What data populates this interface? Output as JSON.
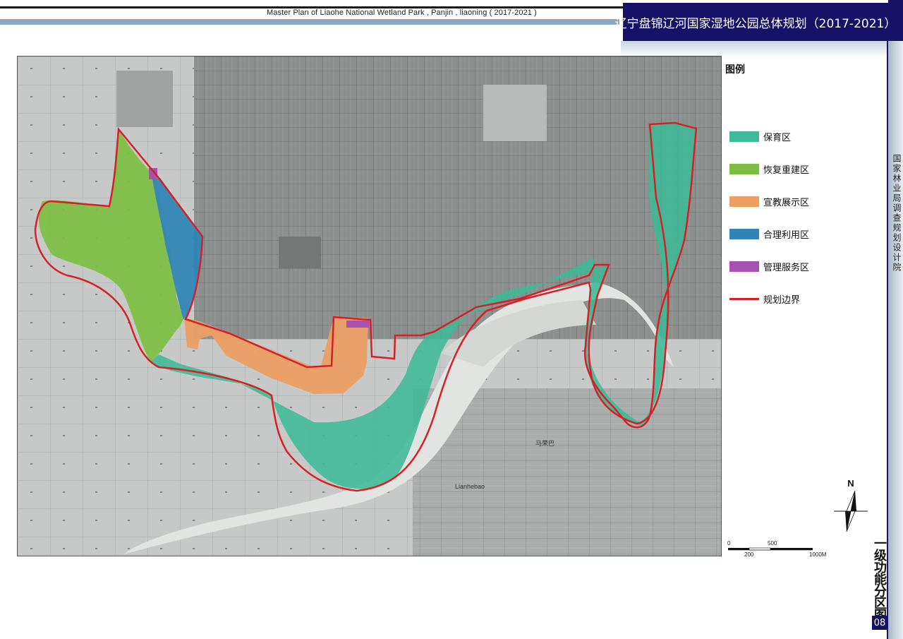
{
  "header": {
    "english_title": "Master Plan of Liaohe National Wetland Park , Panjin , liaoning ( 2017-2021 )",
    "chinese_title": "辽宁盘锦辽河国家湿地公园总体规划（2017-2021）"
  },
  "sidebar": {
    "organization": "国家林业局调查规划设计院",
    "map_title": "一级功能分区图",
    "page_number": "08"
  },
  "legend": {
    "title": "图例",
    "items": [
      {
        "label": "保育区",
        "color": "#3dba97",
        "kind": "fill"
      },
      {
        "label": "恢复重建区",
        "color": "#7cbe42",
        "kind": "fill"
      },
      {
        "label": "宣教展示区",
        "color": "#ec9e64",
        "kind": "fill"
      },
      {
        "label": "合理利用区",
        "color": "#2f86b6",
        "kind": "fill"
      },
      {
        "label": "管理服务区",
        "color": "#a84fb0",
        "kind": "fill"
      },
      {
        "label": "规划边界",
        "color": "#d42028",
        "kind": "line"
      }
    ]
  },
  "map": {
    "place_labels": [
      "马荣巴",
      "Lianhebao"
    ]
  },
  "compass": {
    "north_label": "N"
  },
  "scale_bar": {
    "top_labels": [
      "0",
      "500"
    ],
    "bottom_labels": [
      "200",
      "1000M"
    ]
  }
}
